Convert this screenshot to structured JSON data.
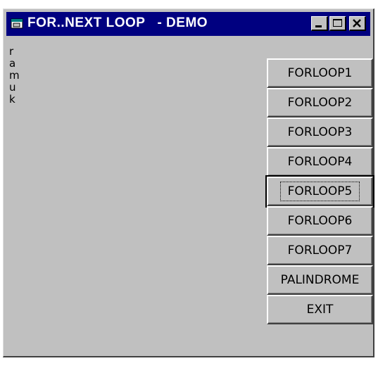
{
  "window": {
    "title": "FOR..NEXT LOOP   - DEMO"
  },
  "icons": {
    "app": "app-window-icon",
    "minimize": "minimize-icon",
    "maximize": "maximize-icon",
    "close": "close-icon"
  },
  "output": {
    "lines": [
      "r",
      "a",
      "m",
      "u",
      "k"
    ]
  },
  "buttons": [
    {
      "label": "FORLOOP1"
    },
    {
      "label": "FORLOOP2"
    },
    {
      "label": "FORLOOP3"
    },
    {
      "label": "FORLOOP4"
    },
    {
      "label": "FORLOOP5",
      "focused": true
    },
    {
      "label": "FORLOOP6"
    },
    {
      "label": "FORLOOP7"
    },
    {
      "label": "PALINDROME"
    },
    {
      "label": "EXIT"
    }
  ]
}
